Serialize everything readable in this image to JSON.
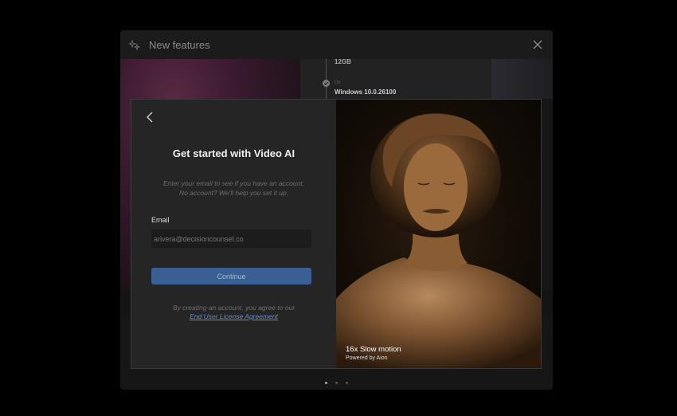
{
  "background_window": {
    "title": "New features",
    "info": {
      "ram": "12GB",
      "os_label": "OS",
      "os_value": "Windows 10.0.26100"
    },
    "page_indicator": {
      "count": 3,
      "active": 0
    }
  },
  "modal": {
    "heading": "Get started with Video AI",
    "subtext_line1": "Enter your email to see if you have an account.",
    "subtext_line2": "No account? We'll help you set it up.",
    "email_label": "Email",
    "email_value": "arivera@decisioncounsel.co",
    "continue_label": "Continue",
    "terms_text": "By creating an account, you agree to our",
    "eula_link": "End User License Agreement",
    "preview": {
      "caption_title": "16x Slow motion",
      "caption_sub": "Powered by Aion"
    }
  },
  "colors": {
    "accent": "#3a5f93",
    "link": "#5b8fd4",
    "panel": "#252526"
  },
  "icons": [
    "sparkle-icon",
    "close-icon",
    "chevron-left-icon",
    "check-circle-icon"
  ]
}
